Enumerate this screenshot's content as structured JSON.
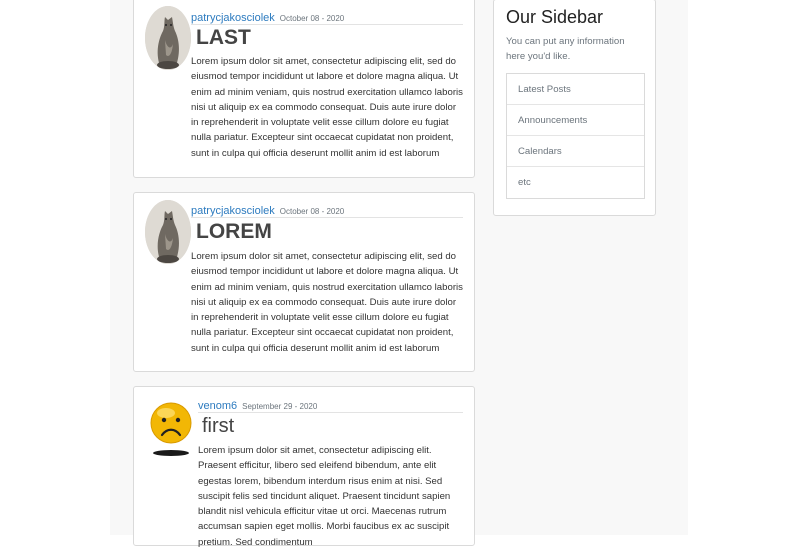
{
  "posts": [
    {
      "author": "patrycjakosciolek",
      "date": "October 08 - 2020",
      "title": "LAST",
      "avatar": "cat-photo",
      "content": "Lorem ipsum dolor sit amet, consectetur adipiscing elit, sed do eiusmod tempor incididunt ut labore et dolore magna aliqua. Ut enim ad minim veniam, quis nostrud exercitation ullamco laboris nisi ut aliquip ex ea commodo consequat. Duis aute irure dolor in reprehenderit in voluptate velit esse cillum dolore eu fugiat nulla pariatur. Excepteur sint occaecat cupidatat non proident, sunt in culpa qui officia deserunt mollit anim id est laborum"
    },
    {
      "author": "patrycjakosciolek",
      "date": "October 08 - 2020",
      "title": "LOREM",
      "avatar": "cat-photo",
      "content": "Lorem ipsum dolor sit amet, consectetur adipiscing elit, sed do eiusmod tempor incididunt ut labore et dolore magna aliqua. Ut enim ad minim veniam, quis nostrud exercitation ullamco laboris nisi ut aliquip ex ea commodo consequat. Duis aute irure dolor in reprehenderit in voluptate velit esse cillum dolore eu fugiat nulla pariatur. Excepteur sint occaecat cupidatat non proident, sunt in culpa qui officia deserunt mollit anim id est laborum"
    },
    {
      "author": "venom6",
      "date": "September 29 - 2020",
      "title": "first",
      "avatar": "sad-face",
      "content": "Lorem ipsum dolor sit amet, consectetur adipiscing elit. Praesent efficitur, libero sed eleifend bibendum, ante elit egestas lorem, bibendum interdum risus enim at nisi. Sed suscipit felis sed tincidunt aliquet. Praesent tincidunt sapien blandit nisl vehicula efficitur vitae ut orci. Maecenas rutrum accumsan sapien eget mollis. Morbi faucibus ex ac suscipit pretium. Sed condimentum"
    }
  ],
  "sidebar": {
    "title": "Our Sidebar",
    "description": "You can put any information here you'd like.",
    "items": [
      "Latest Posts",
      "Announcements",
      "Calendars",
      "etc"
    ]
  },
  "colors": {
    "link": "#2d7bbf",
    "muted": "#6c757d",
    "page_background": "#f8f8f8",
    "card_border": "#dadada"
  }
}
